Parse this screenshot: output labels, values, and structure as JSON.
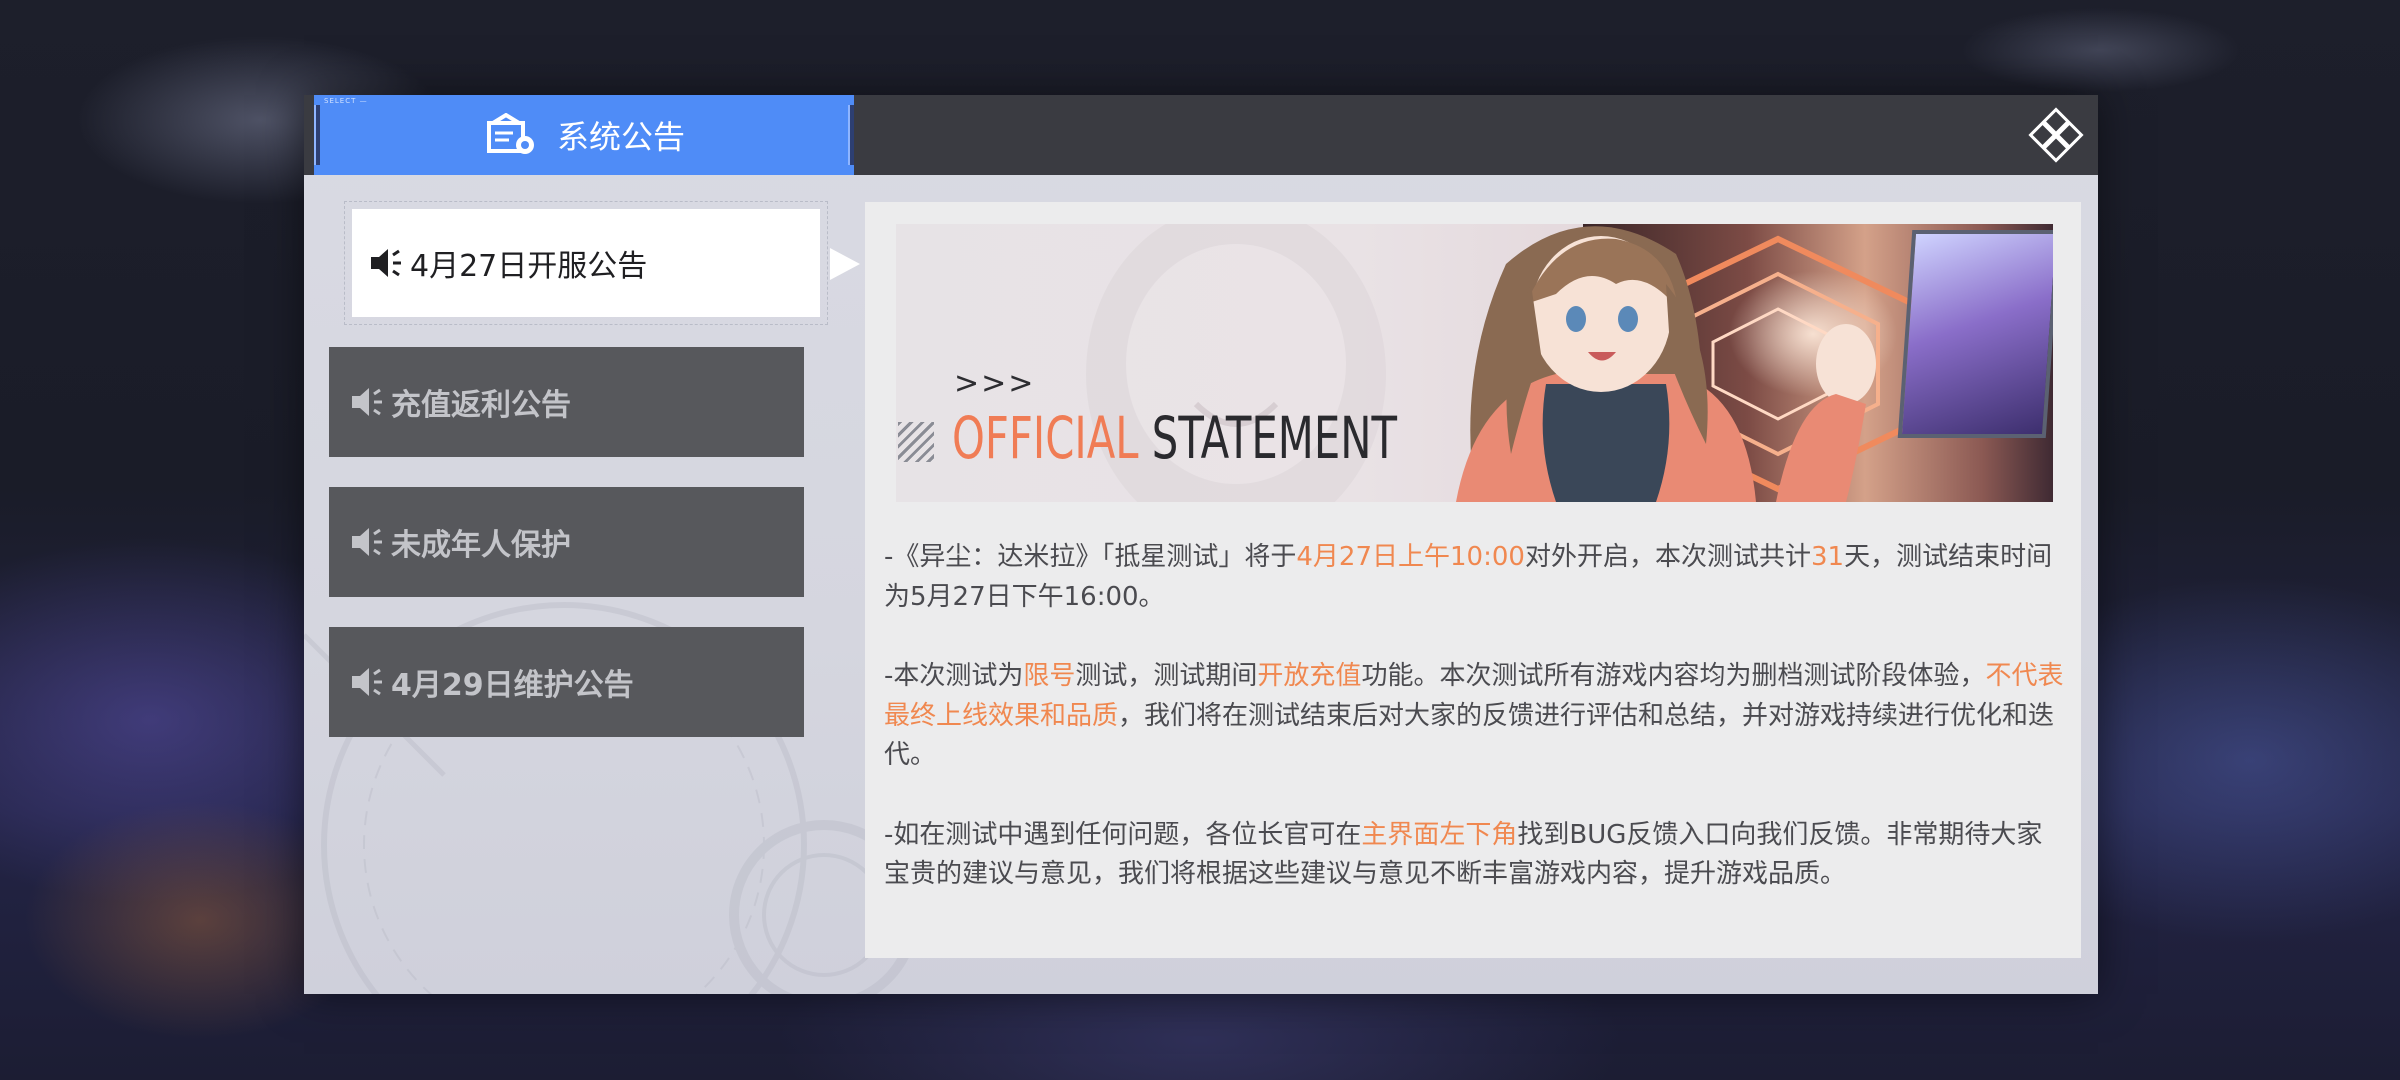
{
  "dialog": {
    "tab": {
      "select_tag": "SELECT —",
      "label": "系统公告"
    },
    "close_label": "Close",
    "accent_color": "#4f8cf7",
    "highlight_color": "#f08850"
  },
  "nav": {
    "items": [
      {
        "label": "4月27日开服公告",
        "active": true
      },
      {
        "label": "充值返利公告",
        "active": false
      },
      {
        "label": "未成年人保护",
        "active": false
      },
      {
        "label": "4月29日维护公告",
        "active": false
      }
    ]
  },
  "banner": {
    "arrows": ">>>",
    "title_word1": "OFFICIAL",
    "title_word2": "STATEMENT"
  },
  "content": {
    "p1": {
      "t1": "-《异尘：达米拉》「抵星测试」将于",
      "h1": "4月27日上午10:00",
      "t2": "对外开启，本次测试共计",
      "h2": "31",
      "t3": "天，测试结束时间为5月27日下午16:00。"
    },
    "p2": {
      "t1": "-本次测试为",
      "h1": "限号",
      "t2": "测试，测试期间",
      "h2": "开放充值",
      "t3": "功能。本次测试所有游戏内容均为删档测试阶段体验，",
      "h3": "不代表最终上线效果和品质",
      "t4": "，我们将在测试结束后对大家的反馈进行评估和总结，并对游戏持续进行优化和迭代。"
    },
    "p3": {
      "t1": "-如在测试中遇到任何问题，各位长官可在",
      "h1": "主界面左下角",
      "t2": "找到BUG反馈入口向我们反馈。非常期待大家宝贵的建议与意见，我们将根据这些建议与意见不断丰富游戏内容，提升游戏品质。"
    }
  }
}
